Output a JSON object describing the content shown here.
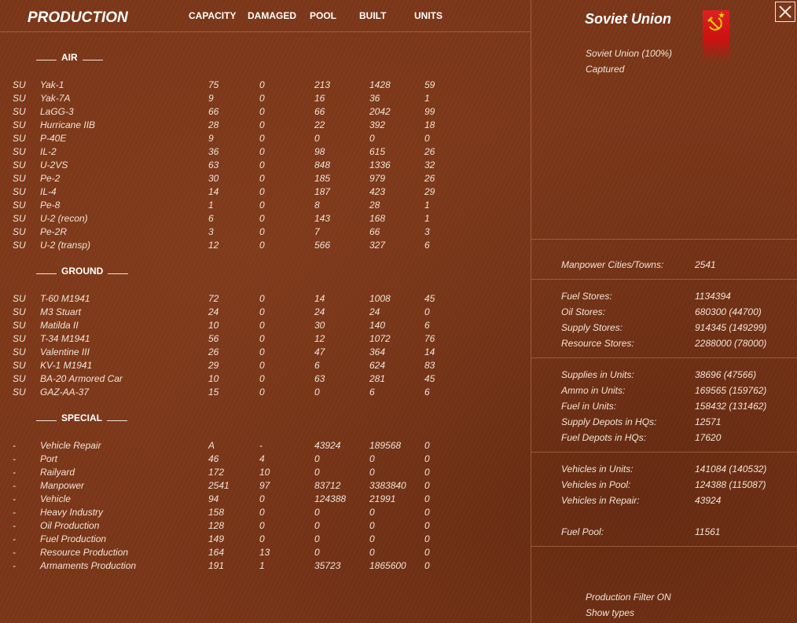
{
  "header": {
    "title": "PRODUCTION",
    "columns": [
      "CAPACITY",
      "DAMAGED",
      "POOL",
      "BUILT",
      "UNITS"
    ]
  },
  "sections": {
    "air": "AIR",
    "ground": "GROUND",
    "special": "SPECIAL"
  },
  "air_rows": [
    [
      "SU",
      "Yak-1",
      "75",
      "0",
      "213",
      "1428",
      "59"
    ],
    [
      "SU",
      "Yak-7A",
      "9",
      "0",
      "16",
      "36",
      "1"
    ],
    [
      "SU",
      "LaGG-3",
      "66",
      "0",
      "66",
      "2042",
      "99"
    ],
    [
      "SU",
      "Hurricane IIB",
      "28",
      "0",
      "22",
      "392",
      "18"
    ],
    [
      "SU",
      "P-40E",
      "9",
      "0",
      "0",
      "0",
      "0"
    ],
    [
      "SU",
      "IL-2",
      "36",
      "0",
      "98",
      "615",
      "26"
    ],
    [
      "SU",
      "U-2VS",
      "63",
      "0",
      "848",
      "1336",
      "32"
    ],
    [
      "SU",
      "Pe-2",
      "30",
      "0",
      "185",
      "979",
      "26"
    ],
    [
      "SU",
      "IL-4",
      "14",
      "0",
      "187",
      "423",
      "29"
    ],
    [
      "SU",
      "Pe-8",
      "1",
      "0",
      "8",
      "28",
      "1"
    ],
    [
      "SU",
      "U-2 (recon)",
      "6",
      "0",
      "143",
      "168",
      "1"
    ],
    [
      "SU",
      "Pe-2R",
      "3",
      "0",
      "7",
      "66",
      "3"
    ],
    [
      "SU",
      "U-2 (transp)",
      "12",
      "0",
      "566",
      "327",
      "6"
    ]
  ],
  "ground_rows": [
    [
      "SU",
      "T-60 M1941",
      "72",
      "0",
      "14",
      "1008",
      "45"
    ],
    [
      "SU",
      "M3 Stuart",
      "24",
      "0",
      "24",
      "24",
      "0"
    ],
    [
      "SU",
      "Matilda II",
      "10",
      "0",
      "30",
      "140",
      "6"
    ],
    [
      "SU",
      "T-34 M1941",
      "56",
      "0",
      "12",
      "1072",
      "76"
    ],
    [
      "SU",
      "Valentine III",
      "26",
      "0",
      "47",
      "364",
      "14"
    ],
    [
      "SU",
      "KV-1 M1941",
      "29",
      "0",
      "6",
      "624",
      "83"
    ],
    [
      "SU",
      "BA-20 Armored Car",
      "10",
      "0",
      "63",
      "281",
      "45"
    ],
    [
      "SU",
      "GAZ-AA-37",
      "15",
      "0",
      "0",
      "6",
      "6"
    ]
  ],
  "special_rows": [
    [
      "-",
      "Vehicle Repair",
      "A",
      "-",
      "43924",
      "189568",
      "0"
    ],
    [
      "-",
      "Port",
      "46",
      "4",
      "0",
      "0",
      "0"
    ],
    [
      "-",
      "Railyard",
      "172",
      "10",
      "0",
      "0",
      "0"
    ],
    [
      "-",
      "Manpower",
      "2541",
      "97",
      "83712",
      "3383840",
      "0"
    ],
    [
      "-",
      "Vehicle",
      "94",
      "0",
      "124388",
      "21991",
      "0"
    ],
    [
      "-",
      "Heavy Industry",
      "158",
      "0",
      "0",
      "0",
      "0"
    ],
    [
      "-",
      "Oil Production",
      "128",
      "0",
      "0",
      "0",
      "0"
    ],
    [
      "-",
      "Fuel Production",
      "149",
      "0",
      "0",
      "0",
      "0"
    ],
    [
      "-",
      "Resource Production",
      "164",
      "13",
      "0",
      "0",
      "0"
    ],
    [
      "-",
      "Armaments Production",
      "191",
      "1",
      "35723",
      "1865600",
      "0"
    ]
  ],
  "nation": {
    "name": "Soviet Union",
    "control": "Soviet Union  (100%)",
    "captured": "Captured",
    "flag_icon": "hammer-sickle-icon",
    "flag_color": "#cc1111"
  },
  "stats": {
    "manpower": [
      [
        "Manpower Cities/Towns:",
        "2541"
      ]
    ],
    "stores": [
      [
        "Fuel Stores:",
        "1134394"
      ],
      [
        "Oil Stores:",
        "680300 (44700)"
      ],
      [
        "Supply Stores:",
        "914345 (149299)"
      ],
      [
        "Resource Stores:",
        "2288000 (78000)"
      ]
    ],
    "units": [
      [
        "Supplies in Units:",
        "38696 (47566)"
      ],
      [
        "Ammo in Units:",
        "169565 (159762)"
      ],
      [
        "Fuel in Units:",
        "158432 (131462)"
      ],
      [
        "Supply Depots in HQs:",
        "12571"
      ],
      [
        "Fuel Depots in HQs:",
        "17620"
      ]
    ],
    "vehicles": [
      [
        "Vehicles in Units:",
        "141084 (140532)"
      ],
      [
        "Vehicles in Pool:",
        "124388 (115087)"
      ],
      [
        "Vehicles in Repair:",
        "43924"
      ]
    ],
    "fuel_pool": [
      [
        "Fuel Pool:",
        "11561"
      ]
    ]
  },
  "footer": {
    "filter": "Production Filter ON",
    "show_types": "Show types"
  },
  "close_icon": "close-icon"
}
